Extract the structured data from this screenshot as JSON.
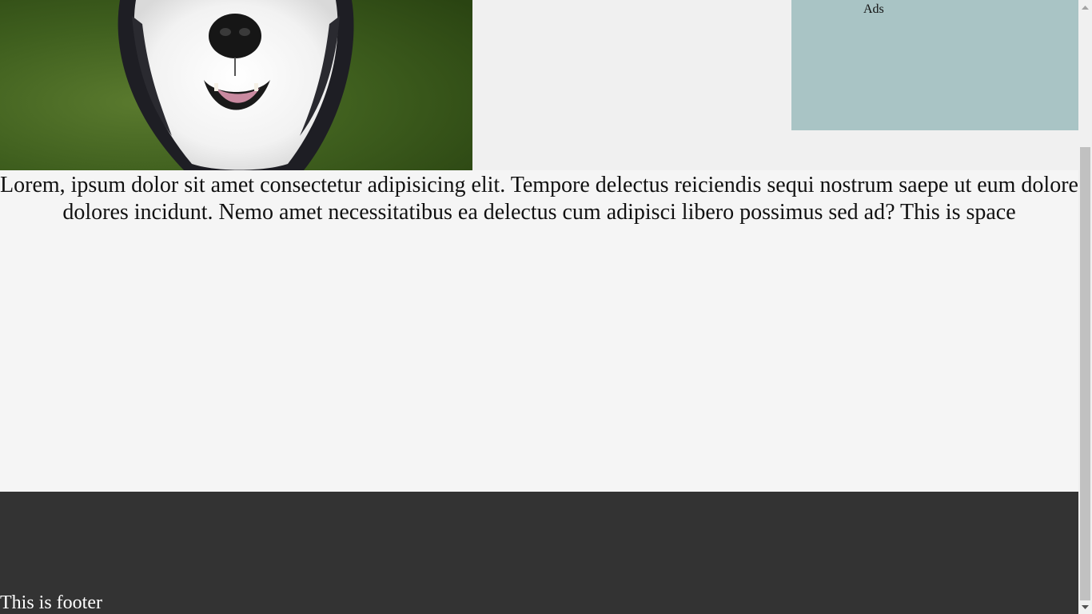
{
  "ads": {
    "label": "Ads"
  },
  "main": {
    "text": "Lorem, ipsum dolor sit amet consectetur adipisicing elit. Tempore delectus reiciendis sequi nostrum saepe ut eum dolore dolores incidunt. Nemo amet necessitatibus ea delectus cum adipisci libero possimus sed ad? This is space"
  },
  "footer": {
    "text": "This is footer"
  },
  "colors": {
    "ads_background": "#a9c4c5",
    "footer_background": "#333333",
    "page_background": "#f0f0f0",
    "main_background": "#f5f5f5"
  },
  "icons": {
    "hero": "husky-dog-photo",
    "scroll_up": "scroll-up-arrow-icon",
    "scroll_down": "scroll-down-arrow-icon"
  }
}
